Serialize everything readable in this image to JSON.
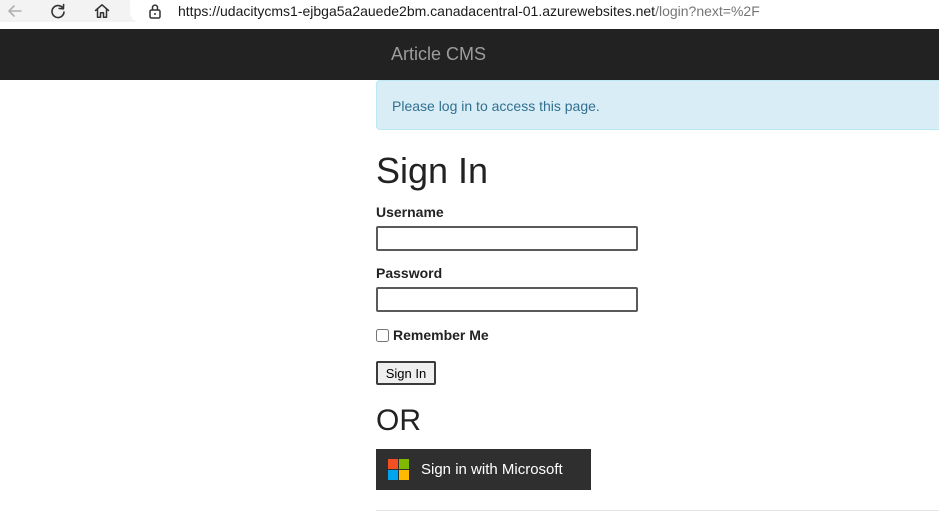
{
  "browser": {
    "url_host": "https://udacitycms1-ejbga5a2auede2bm.canadacentral-01.azurewebsites.net",
    "url_path": "/login?next=%2F"
  },
  "navbar": {
    "brand": "Article CMS"
  },
  "alert": {
    "message": "Please log in to access this page."
  },
  "form": {
    "title": "Sign In",
    "username_label": "Username",
    "username_value": "",
    "password_label": "Password",
    "password_value": "",
    "remember_label": "Remember Me",
    "remember_checked": false,
    "submit_label": "Sign In"
  },
  "alt_login": {
    "or_text": "OR",
    "microsoft_label": "Sign in with Microsoft",
    "microsoft_logo_colors": [
      "#f25022",
      "#7fba00",
      "#00a4ef",
      "#ffb900"
    ]
  },
  "icons": {
    "back": "back-arrow-icon",
    "refresh": "refresh-icon",
    "home": "home-icon",
    "lock": "lock-icon",
    "microsoft": "microsoft-logo-icon"
  }
}
